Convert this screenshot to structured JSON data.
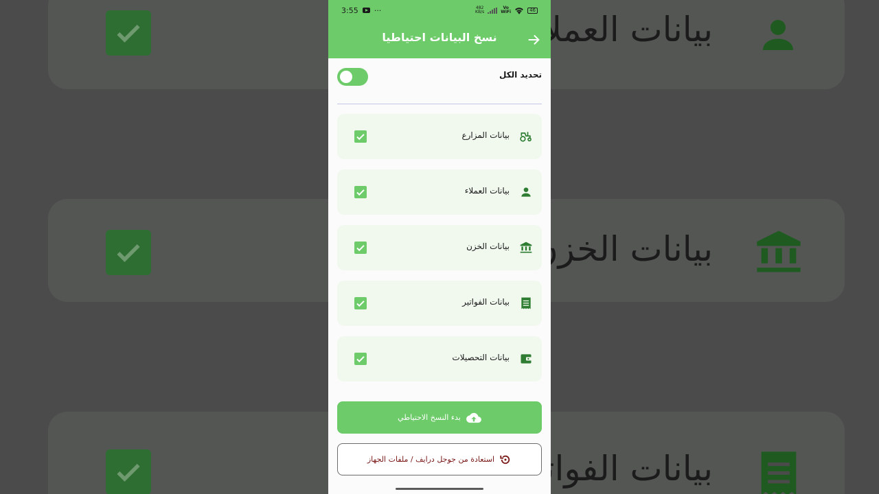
{
  "status_bar": {
    "time": "3:55",
    "net_speed_top": "482",
    "net_speed_bottom": "KB/s",
    "volte_top": "Vo",
    "volte_bottom": "WiFi",
    "battery": "46"
  },
  "header": {
    "title": "نسخ البيانات احتياطيا"
  },
  "select_all": {
    "label": "تحديد الكل",
    "enabled": false
  },
  "items": [
    {
      "label": "بيانات المزارع",
      "icon": "tractor-icon",
      "checked": true
    },
    {
      "label": "بيانات العملاء",
      "icon": "person-icon",
      "checked": true
    },
    {
      "label": "بيانات الخزن",
      "icon": "bank-icon",
      "checked": true
    },
    {
      "label": "بيانات الفواتير",
      "icon": "receipt-icon",
      "checked": true
    },
    {
      "label": "بيانات التحصيلات",
      "icon": "wallet-icon",
      "checked": true
    }
  ],
  "actions": {
    "backup_label": "بدء النسخ الاحتياطي",
    "restore_label": "استعادة من جوجل درايف / ملفات الجهاز"
  },
  "background": {
    "text_1": "بيانات العملاء",
    "text_2": "بيانات الخزن",
    "text_3": "بيانات الفواتير"
  },
  "colors": {
    "primary": "#6dcb6a",
    "icon_green": "#2e7d32",
    "card_bg": "#f1f9ef",
    "restore_text": "#7a1717"
  }
}
